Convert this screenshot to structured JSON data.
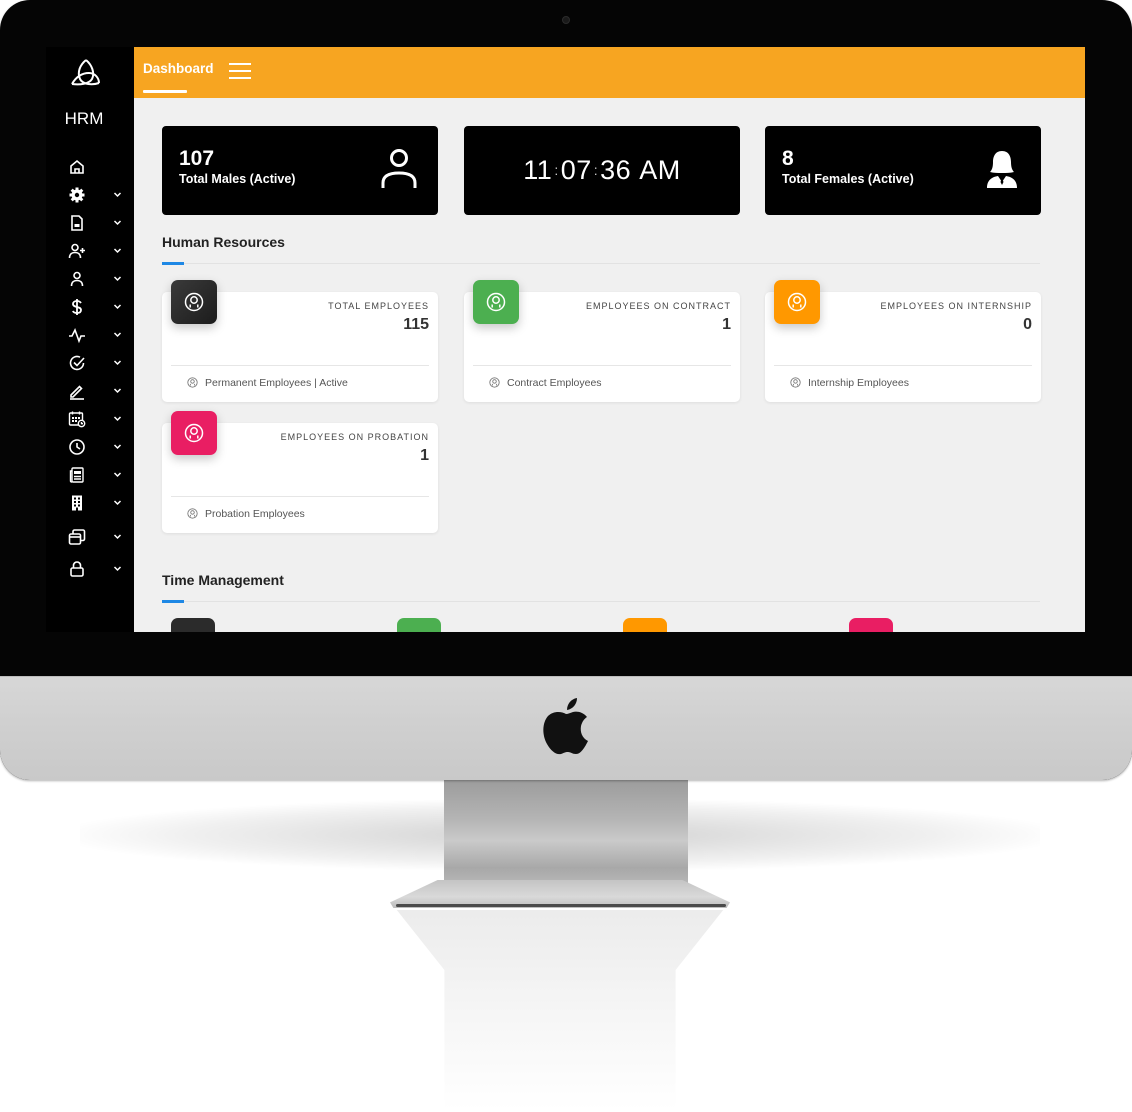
{
  "app": {
    "brand_name": "HRM",
    "accent_color": "#f7a521"
  },
  "topbar": {
    "active_tab": "Dashboard",
    "menu_icon": "hamburger-icon"
  },
  "sidebar": {
    "items": [
      {
        "icon": "home-icon",
        "has_chevron": false
      },
      {
        "icon": "gear-icon",
        "has_chevron": true
      },
      {
        "icon": "document-icon",
        "has_chevron": true
      },
      {
        "icon": "user-plus-icon",
        "has_chevron": true
      },
      {
        "icon": "user-icon",
        "has_chevron": true
      },
      {
        "icon": "dollar-icon",
        "has_chevron": true
      },
      {
        "icon": "activity-icon",
        "has_chevron": true
      },
      {
        "icon": "check-circle-icon",
        "has_chevron": true
      },
      {
        "icon": "pencil-icon",
        "has_chevron": true
      },
      {
        "icon": "calendar-clock-icon",
        "has_chevron": true
      },
      {
        "icon": "clock-icon",
        "has_chevron": true
      },
      {
        "icon": "newspaper-icon",
        "has_chevron": true
      },
      {
        "icon": "building-icon",
        "has_chevron": true
      },
      {
        "icon": "windows-icon",
        "has_chevron": true
      },
      {
        "icon": "lock-icon",
        "has_chevron": true
      }
    ]
  },
  "summary": {
    "males": {
      "value": "107",
      "label": "Total Males (Active)",
      "icon": "user-outline-icon"
    },
    "clock": {
      "hours": "11",
      "minutes": "07",
      "seconds": "36",
      "period": "AM"
    },
    "females": {
      "value": "8",
      "label": "Total Females (Active)",
      "icon": "female-user-icon"
    }
  },
  "sections": {
    "human_resources": {
      "title": "Human Resources",
      "cards": [
        {
          "title": "TOTAL EMPLOYEES",
          "value": "115",
          "footer": "Permanent Employees | Active",
          "color": "#2b2b2b"
        },
        {
          "title": "EMPLOYEES ON CONTRACT",
          "value": "1",
          "footer": "Contract Employees",
          "color": "#4caf50"
        },
        {
          "title": "EMPLOYEES ON INTERNSHIP",
          "value": "0",
          "footer": "Internship Employees",
          "color": "#ff9800"
        },
        {
          "title": "EMPLOYEES ON PROBATION",
          "value": "1",
          "footer": "Probation Employees",
          "color": "#e91e63"
        }
      ]
    },
    "time_management": {
      "title": "Time Management",
      "badge_colors": [
        "#2b2b2b",
        "#4caf50",
        "#ff9800",
        "#e91e63"
      ]
    }
  }
}
